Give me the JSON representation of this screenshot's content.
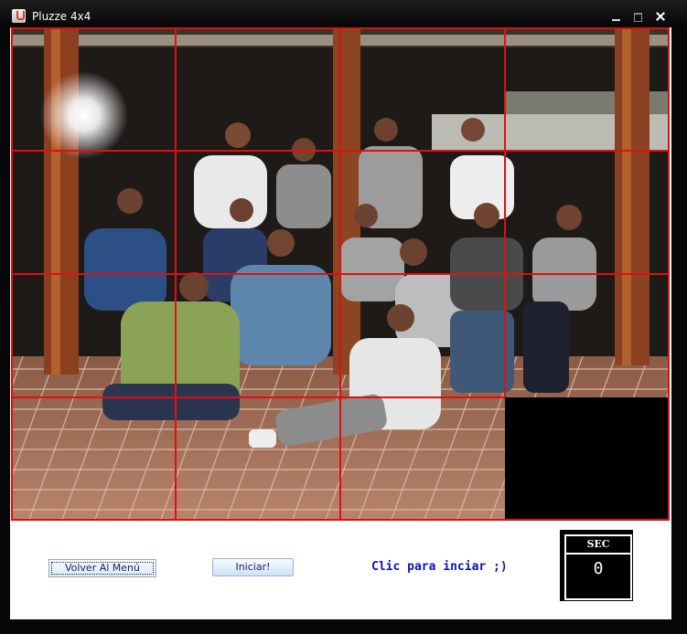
{
  "window": {
    "title": "Pluzze 4x4"
  },
  "board": {
    "rows": 4,
    "cols": 4,
    "empty_cell": {
      "row": 3,
      "col": 3
    },
    "grid_color": "#e01010",
    "photo_alt": "Group photo puzzle"
  },
  "controls": {
    "back_label": "Volver Al Menú",
    "start_label": "Iniciar!",
    "status_text": "Clic para inciar ;)"
  },
  "timer": {
    "label": "SEC",
    "value": "0"
  },
  "colors": {
    "status_text": "#0b13b8",
    "timer_bg": "#000000"
  }
}
